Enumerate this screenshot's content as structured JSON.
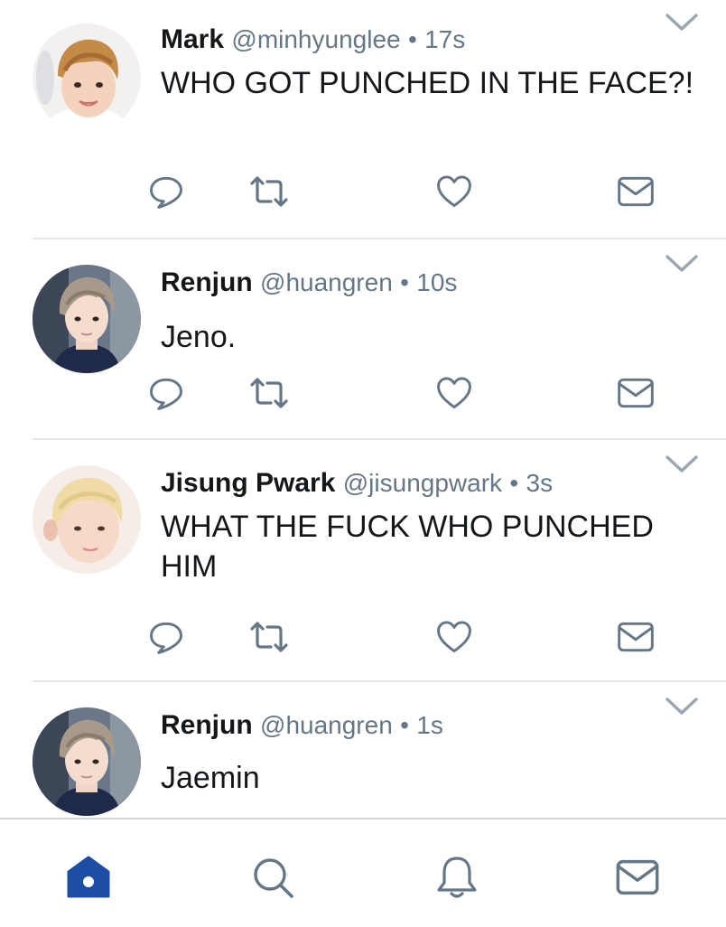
{
  "colors": {
    "text": "#14171a",
    "secondary": "#657786",
    "icon": "#657786",
    "active_tab": "#1d4ea6",
    "divider": "#e1e8ed"
  },
  "tweets": [
    {
      "name": "Mark",
      "handle": "@minhyunglee",
      "dot": "•",
      "time": "17s",
      "text": "WHO GOT PUNCHED IN THE FACE?!"
    },
    {
      "name": "Renjun",
      "handle": "@huangren",
      "dot": "•",
      "time": "10s",
      "text": "Jeno."
    },
    {
      "name": "Jisung Pwark",
      "handle": "@jisungpwark",
      "dot": "•",
      "time": "3s",
      "text": "WHAT THE FUCK WHO PUNCHED HIM"
    },
    {
      "name": "Renjun",
      "handle": "@huangren",
      "dot": "•",
      "time": "1s",
      "text": "Jaemin"
    }
  ],
  "action_icons": [
    "reply-icon",
    "retweet-icon",
    "like-icon",
    "direct-message-icon"
  ],
  "tabbar": {
    "active": "home",
    "tabs": [
      "home-icon",
      "search-icon",
      "notifications-icon",
      "messages-icon"
    ]
  }
}
